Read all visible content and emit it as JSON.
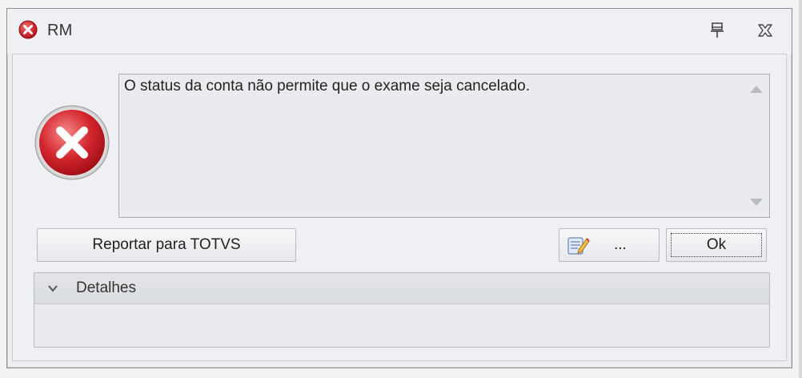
{
  "window": {
    "title": "RM",
    "pin_icon": "pin-icon",
    "close_icon": "close-icon"
  },
  "message": {
    "icon": "error-icon",
    "text": "O status da conta não permite que o exame seja cancelado."
  },
  "buttons": {
    "report_label": "Reportar para TOTVS",
    "more_label": "...",
    "more_icon": "notepad-icon",
    "ok_label": "Ok"
  },
  "details": {
    "label": "Detalhes",
    "chevron_icon": "chevron-down-icon"
  },
  "colors": {
    "error_red": "#d0222a",
    "border": "#a9adb3",
    "background": "#eef0f3"
  }
}
